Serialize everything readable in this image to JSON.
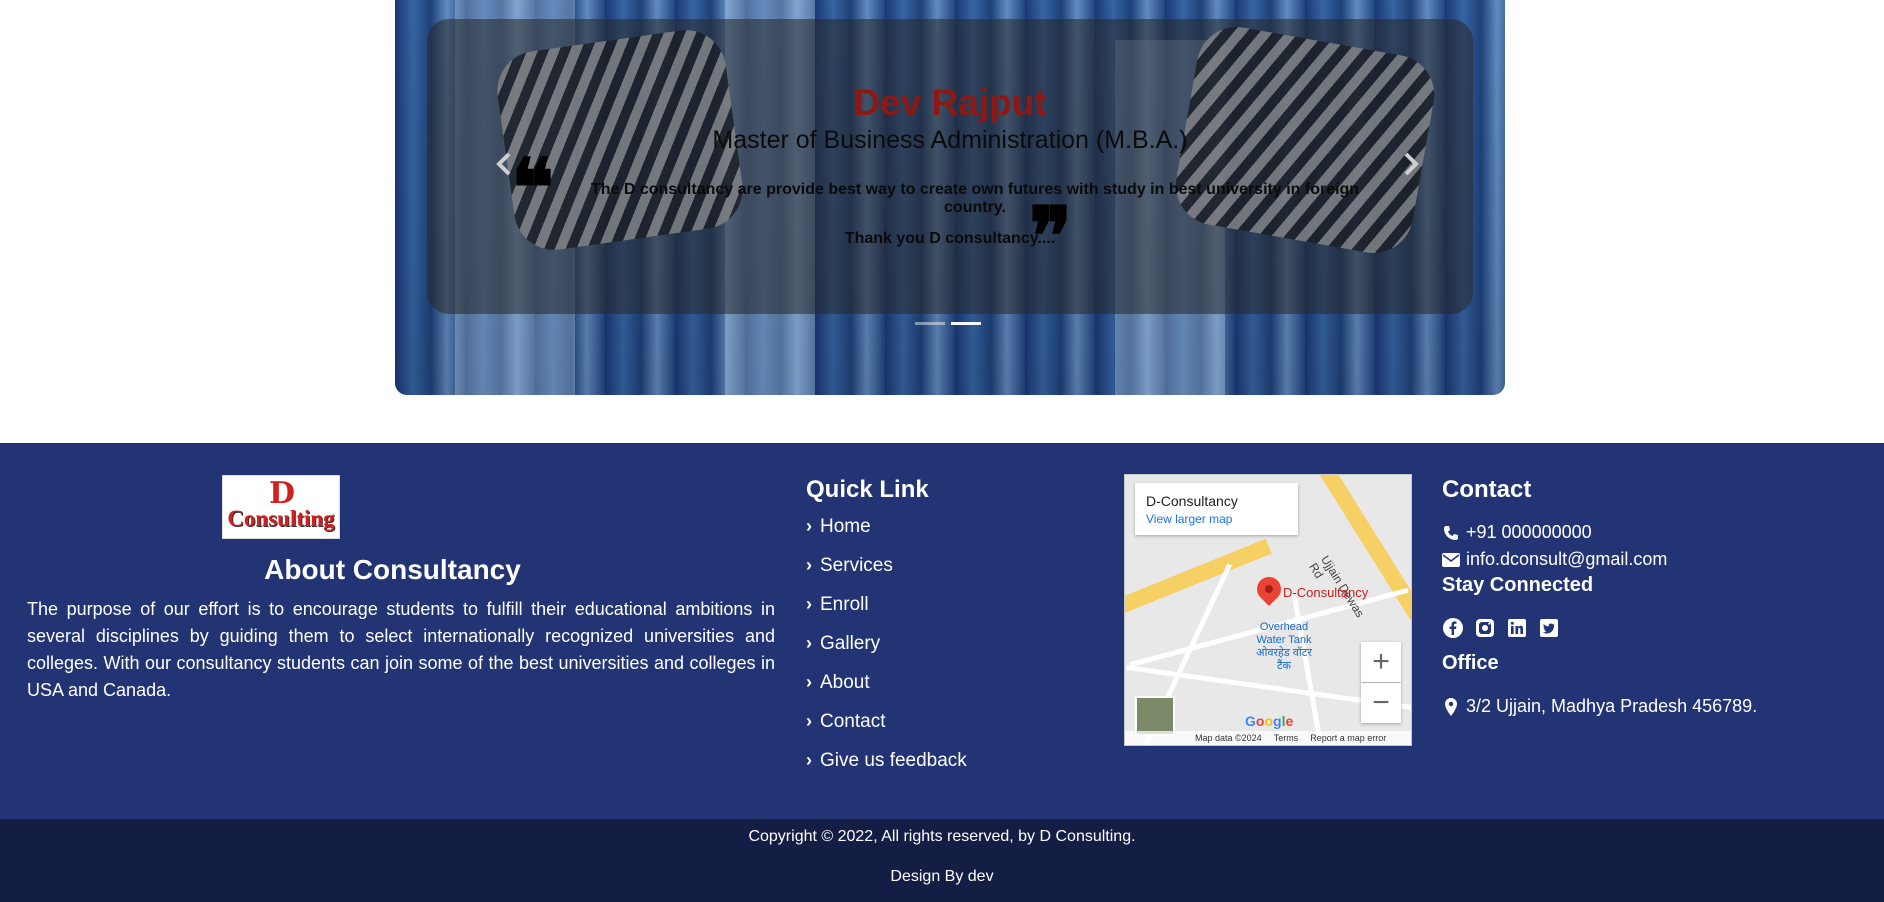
{
  "testimonial": {
    "name": "Dev Rajput",
    "degree": "Master of Business Administration (M.B.A.)",
    "quote": "The D consultancy are provide best way to create own futures with study in best university in foreign country.",
    "thanks": "Thank you D consultancy....",
    "prev_icon": "chevron-left-icon",
    "next_icon": "chevron-right-icon",
    "open_quote": "❝",
    "close_quote": "❞"
  },
  "about": {
    "logo_text": "Consulting",
    "logo_letter": "D",
    "title": "About Consultancy",
    "text": "The purpose of our effort is to encourage students to fulfill their educational ambitions in several disciplines by guiding them to select internationally recognized universities and colleges. With our consultancy students can join some of the best universities and colleges in USA and Canada."
  },
  "quick_links": {
    "title": "Quick Link",
    "items": [
      "Home",
      "Services",
      "Enroll",
      "Gallery",
      "About",
      "Contact",
      "Give us feedback"
    ]
  },
  "map": {
    "place_name": "D-Consultancy",
    "view_larger": "View larger map",
    "pin_label": "D-Consultancy",
    "poi": "Overhead Water Tank ओवरहेड वॉटर टैंक",
    "road_label": "Ujjain Dewas Rd",
    "google": "Google",
    "footer_items": [
      "Map data ©2024",
      "Terms",
      "Report a map error"
    ]
  },
  "contact": {
    "title": "Contact",
    "phone": "+91 000000000",
    "email": "info.dconsult@gmail.com",
    "stay_title": "Stay Connected",
    "social": [
      "facebook-icon",
      "instagram-icon",
      "linkedin-icon",
      "twitter-icon"
    ],
    "office_title": "Office",
    "address": "3/2 Ujjain, Madhya Pradesh 456789."
  },
  "bottom": {
    "copyright": "Copyright © 2022, All rights reserved, by D Consulting.",
    "design": "Design By dev"
  },
  "colors": {
    "footer": "#223473",
    "bottom": "#141d44",
    "name": "#8b1a14"
  }
}
